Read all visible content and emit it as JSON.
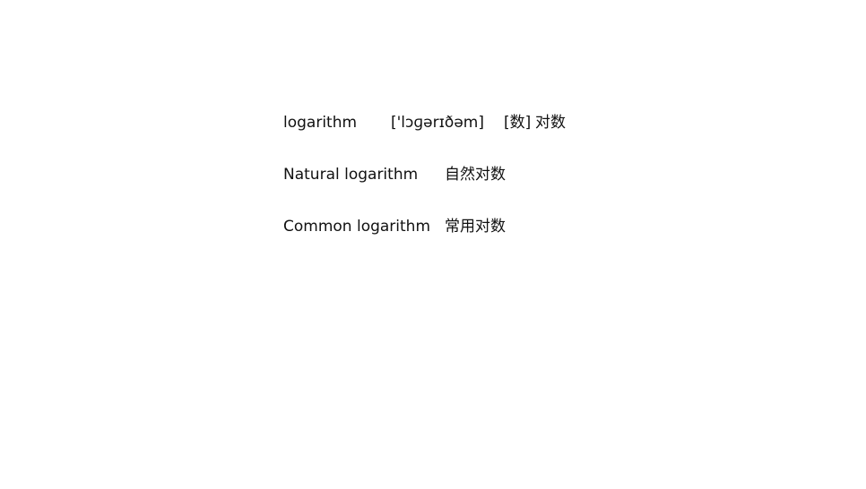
{
  "entries": [
    {
      "term": "logarithm",
      "phonetic": "['lɔɡərɪðəm]",
      "pos": "[数]",
      "definition": "对数"
    },
    {
      "term": "Natural logarithm",
      "definition": "自然对数"
    },
    {
      "term": "Common logarithm",
      "definition": "常用对数"
    }
  ]
}
